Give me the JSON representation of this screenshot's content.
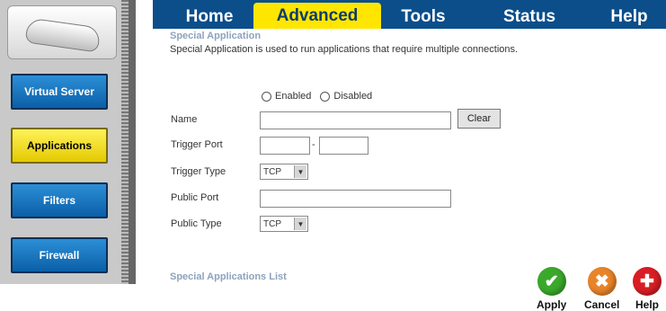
{
  "tabs": [
    "Home",
    "Advanced",
    "Tools",
    "Status",
    "Help"
  ],
  "sidebar": [
    "Virtual Server",
    "Applications",
    "Filters",
    "Firewall"
  ],
  "section": {
    "title": "Special Application",
    "description": "Special Application is used to run applications that require multiple connections."
  },
  "form": {
    "enabled_label": "Enabled",
    "disabled_label": "Disabled",
    "name_label": "Name",
    "clear_label": "Clear",
    "trigger_port_label": "Trigger Port",
    "port_separator": "-",
    "trigger_type_label": "Trigger Type",
    "trigger_type_value": "TCP",
    "public_port_label": "Public Port",
    "public_type_label": "Public Type",
    "public_type_value": "TCP"
  },
  "list_title": "Special Applications List",
  "actions": {
    "apply": "Apply",
    "cancel": "Cancel",
    "help": "Help"
  },
  "colors": {
    "tab_bar": "#0b4e8a",
    "active_tab": "#ffe600",
    "apply": "#3aa92b",
    "cancel": "#e8842a",
    "help": "#d81e24"
  },
  "icons": {
    "apply": "checkmark-icon",
    "cancel": "x-icon",
    "help": "plus-icon"
  }
}
